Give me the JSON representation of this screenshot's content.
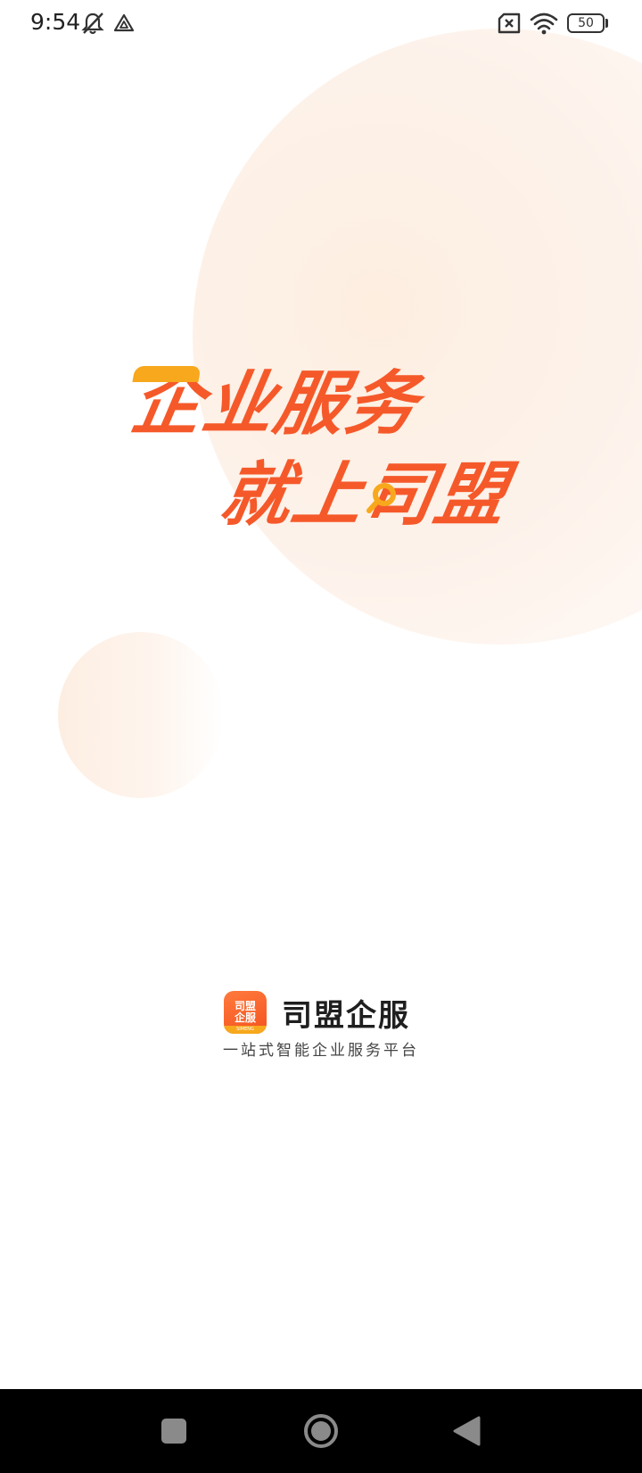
{
  "status_bar": {
    "time": "9:54",
    "battery": "50",
    "icons": [
      "bell-mute-icon",
      "nav-triangle-icon",
      "sim-off-icon",
      "wifi-icon",
      "battery-icon"
    ]
  },
  "slogan": {
    "line1": "企业服务",
    "line2": "就上司盟"
  },
  "brand": {
    "logo_line1": "司盟",
    "logo_line2": "企服",
    "logo_foot": "SIMENG",
    "name": "司盟企服",
    "tagline": "一站式智能企业服务平台"
  },
  "nav_bar": {
    "buttons": [
      "recents-icon",
      "home-icon",
      "back-icon"
    ]
  },
  "colors": {
    "brand_orange": "#f5592a",
    "accent_yellow": "#f7a81c",
    "circle_tint": "#fdeee0",
    "nav_background": "#000000"
  }
}
